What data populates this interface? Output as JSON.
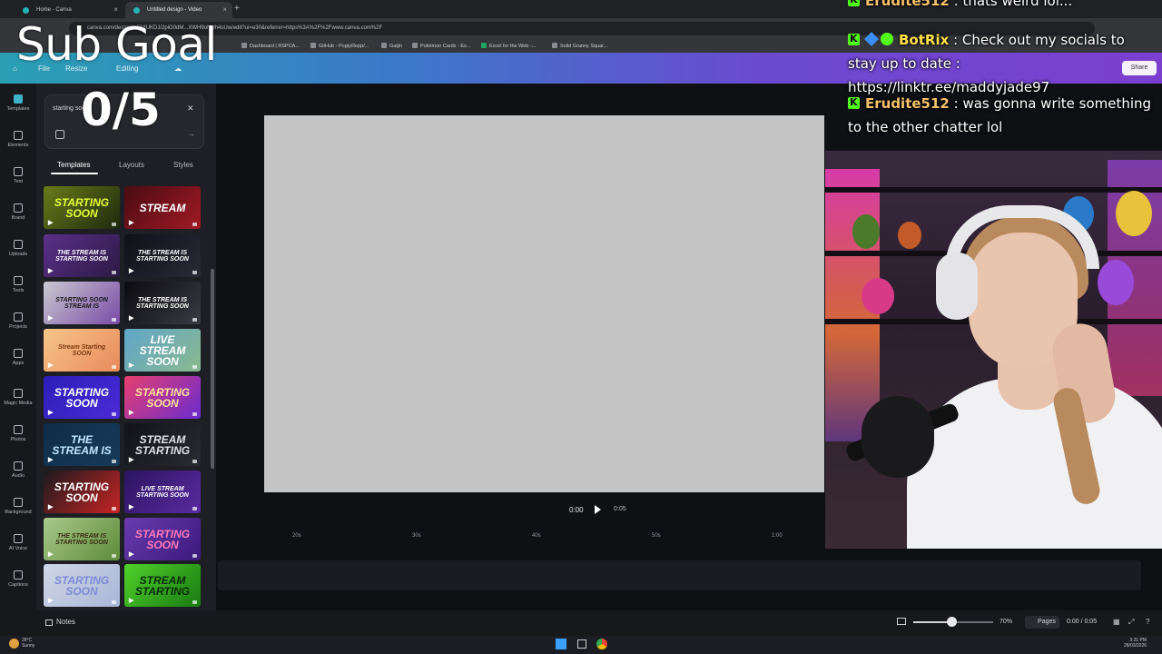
{
  "browser": {
    "tabs": [
      {
        "label": "Home - Canva"
      },
      {
        "label": "Untitled design - Video"
      }
    ],
    "new_tab": "+",
    "url": "canva.com/design/...FNIUKDJ/2piG0dM...XWH9oNUh4sUw/edit?ui=e30&referrer=https%3A%2F%2Fwww.canva.com%2F",
    "bookmarks": [
      {
        "label": "Dashboard | RSPCA..."
      },
      {
        "label": "GitHub - PogtyRepp/..."
      },
      {
        "label": "Gaijin"
      },
      {
        "label": "Pokémon Cards - Ex..."
      },
      {
        "label": "Excel for the Web -..."
      },
      {
        "label": "Solid Granny Squar..."
      }
    ]
  },
  "canva_header": {
    "file": "File",
    "resize": "Resize",
    "editing": "Editing",
    "share": "Share"
  },
  "rail": [
    {
      "label": "Templates",
      "icon": "templates-icon"
    },
    {
      "label": "Elements",
      "icon": "elements-icon"
    },
    {
      "label": "Text",
      "icon": "text-icon"
    },
    {
      "label": "Brand",
      "icon": "brand-icon"
    },
    {
      "label": "Uploads",
      "icon": "uploads-icon"
    },
    {
      "label": "Tools",
      "icon": "tools-icon"
    },
    {
      "label": "Projects",
      "icon": "projects-icon"
    },
    {
      "label": "Apps",
      "icon": "apps-icon"
    },
    {
      "label": "Magic Media",
      "icon": "magic-media-icon"
    },
    {
      "label": "Photos",
      "icon": "photos-icon"
    },
    {
      "label": "Audio",
      "icon": "audio-icon"
    },
    {
      "label": "Background",
      "icon": "background-icon"
    },
    {
      "label": "AI Voice",
      "icon": "ai-voice-icon"
    },
    {
      "label": "Captions",
      "icon": "captions-icon"
    }
  ],
  "panel": {
    "search_value": "starting soon",
    "tabs": [
      {
        "label": "Templates"
      },
      {
        "label": "Layouts"
      },
      {
        "label": "Styles"
      }
    ],
    "thumbnails": [
      {
        "text": "STARTING SOON",
        "bg": "linear-gradient(135deg,#6b7a1a,#1d2a0d)",
        "fg": "#e7ff3a"
      },
      {
        "text": "STREAM",
        "bg": "linear-gradient(135deg,#4a0b12,#a01a25)",
        "fg": "#ffffff"
      },
      {
        "text": "THE STREAM IS STARTING SOON",
        "bg": "linear-gradient(135deg,#5b2f8a,#2b1a44)",
        "fg": "#ffffff"
      },
      {
        "text": "THE STREAM IS STARTING SOON",
        "bg": "linear-gradient(135deg,#101018,#2a2a38)",
        "fg": "#ffffff"
      },
      {
        "text": "STARTING SOON STREAM IS",
        "bg": "linear-gradient(135deg,#c9c9d1,#7a4aa5)",
        "fg": "#1a1a1a"
      },
      {
        "text": "THE STREAM IS STARTING SOON",
        "bg": "linear-gradient(135deg,#0b0b0f,#3a3a44)",
        "fg": "#ffffff"
      },
      {
        "text": "Stream Starting SOON",
        "bg": "linear-gradient(135deg,#f6c58a,#e98a5b)",
        "fg": "#7a3b12"
      },
      {
        "text": "LIVE STREAM SOON",
        "bg": "linear-gradient(135deg,#5fa6c9,#8bb88f)",
        "fg": "#ffffff"
      },
      {
        "text": "STARTING SOON",
        "bg": "linear-gradient(135deg,#2b1fb8,#4b2ad6)",
        "fg": "#ffffff"
      },
      {
        "text": "STARTING SOON",
        "bg": "linear-gradient(135deg,#e5406e,#6b2bd0)",
        "fg": "#ffe59a"
      },
      {
        "text": "THE STREAM IS",
        "bg": "linear-gradient(135deg,#0f2d4a,#163b5a)",
        "fg": "#bfe6ff"
      },
      {
        "text": "STREAM STARTING",
        "bg": "linear-gradient(135deg,#121218,#2a2a34)",
        "fg": "#e0e0e8"
      },
      {
        "text": "STARTING SOON",
        "bg": "linear-gradient(135deg,#1a1a1e,#c72424)",
        "fg": "#ffffff"
      },
      {
        "text": "LIVE STREAM STARTING SOON",
        "bg": "linear-gradient(135deg,#2b1460,#5b2aa0)",
        "fg": "#ffffff"
      },
      {
        "text": "THE STREAM IS STARTING SOON",
        "bg": "linear-gradient(135deg,#a8c98a,#5e8a3a)",
        "fg": "#3a2a12"
      },
      {
        "text": "STARTING SOON",
        "bg": "linear-gradient(135deg,#6a3bb0,#3a1a7a)",
        "fg": "#ff7ab8"
      },
      {
        "text": "STARTING SOON",
        "bg": "linear-gradient(135deg,#cfd6e6,#a9b6d6)",
        "fg": "#7a8bd6"
      },
      {
        "text": "STREAM STARTING",
        "bg": "linear-gradient(135deg,#4fd12a,#1a7a12)",
        "fg": "#0b2a0b"
      }
    ]
  },
  "playback": {
    "current": "0:00",
    "duration": "0:05"
  },
  "timeline_ticks": [
    "20s",
    "30s",
    "40s",
    "50s",
    "1:00"
  ],
  "bottom_bar": {
    "notes": "Notes",
    "zoom": "70%",
    "zoom_fraction": 0.48,
    "pages": "Pages",
    "time": "0:00 / 0:05"
  },
  "taskbar": {
    "temp": "28°C",
    "weather": "Sunny",
    "clock_time": "3:31 PM",
    "clock_date": "28/03/2026"
  },
  "overlay": {
    "subgoal_title": "Sub Goal",
    "subgoal_count": "0/5"
  },
  "chat": [
    {
      "user": "Erudite512",
      "color": "#f5c26b",
      "text": ": thats weird lol..."
    },
    {
      "user": "BotRix",
      "color": "#ffe14a",
      "text": ": Check out my socials to stay up to date : https://linktr.ee/maddyjade97"
    },
    {
      "user": "Erudite512",
      "color": "#f5c26b",
      "text": ": was gonna write something to the other chatter lol"
    }
  ],
  "colors": {
    "kick_green": "#53fc18",
    "canva_teal": "#2a9fb3",
    "canva_purple": "#7b3fcf"
  }
}
